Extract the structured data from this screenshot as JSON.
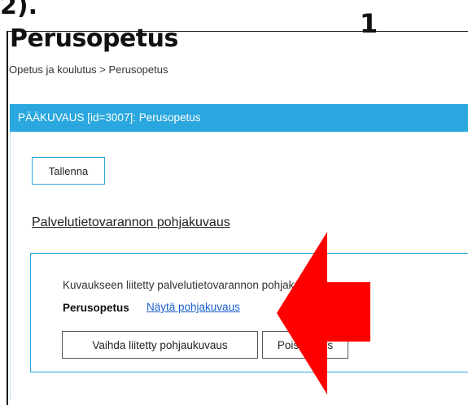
{
  "top_fragment": "2).",
  "step_number": "1",
  "page_title": "Perusopetus",
  "breadcrumb": "Opetus ja koulutus > Perusopetus",
  "section_bar": "PÄÄKUVAUS  [id=3007]: Perusopetus",
  "save_label": "Tallenna",
  "subsection_title": "Palvelutietovarannon pohjakuvaus",
  "linked": {
    "label": "Kuvaukseen liitetty palvelutietovarannon pohjakuvaus:",
    "name": "Perusopetus",
    "show_link": "Näytä pohjakuvaus"
  },
  "buttons": {
    "change": "Vaihda liitetty pohjaukuvaus",
    "remove": "Poista liitos"
  },
  "colors": {
    "accent": "#2aa7de",
    "arrow": "#ff0000",
    "link": "#1a5fd0"
  },
  "icons": [
    "red-arrow-icon"
  ]
}
